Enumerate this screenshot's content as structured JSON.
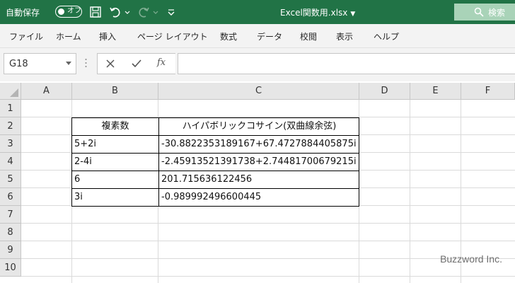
{
  "titlebar": {
    "autosave_label": "自動保存",
    "autosave_state": "オフ",
    "file_title": "Excel関数用.xlsx",
    "search_label": "検索",
    "colors": {
      "bar": "#217346",
      "search": "#a9d3b8"
    }
  },
  "icons": [
    "save-icon",
    "undo-icon",
    "redo-icon",
    "customize-icon",
    "search-icon",
    "cancel-icon",
    "enter-icon",
    "function-icon"
  ],
  "menu": {
    "items": [
      "ファイル",
      "ホーム",
      "挿入",
      "ページ レイアウト",
      "数式",
      "データ",
      "校閲",
      "表示",
      "ヘルプ"
    ]
  },
  "formula_bar": {
    "name_box": "G18",
    "fx_label": "fx",
    "formula": ""
  },
  "sheet": {
    "columns": [
      "A",
      "B",
      "C",
      "D",
      "E",
      "F"
    ],
    "rows": [
      "1",
      "2",
      "3",
      "4",
      "5",
      "6",
      "7",
      "8",
      "9",
      "10"
    ],
    "table": {
      "headers": [
        "複素数",
        "ハイパボリックコサイン(双曲線余弦)"
      ],
      "rows": [
        [
          "5+2i",
          "-30.8822353189167+67.4727884405875i"
        ],
        [
          "2-4i",
          "-2.45913521391738+2.74481700679215i"
        ],
        [
          "6",
          "201.715636122456"
        ],
        [
          "3i",
          "-0.989992496600445"
        ]
      ]
    }
  },
  "watermark": "Buzzword Inc."
}
